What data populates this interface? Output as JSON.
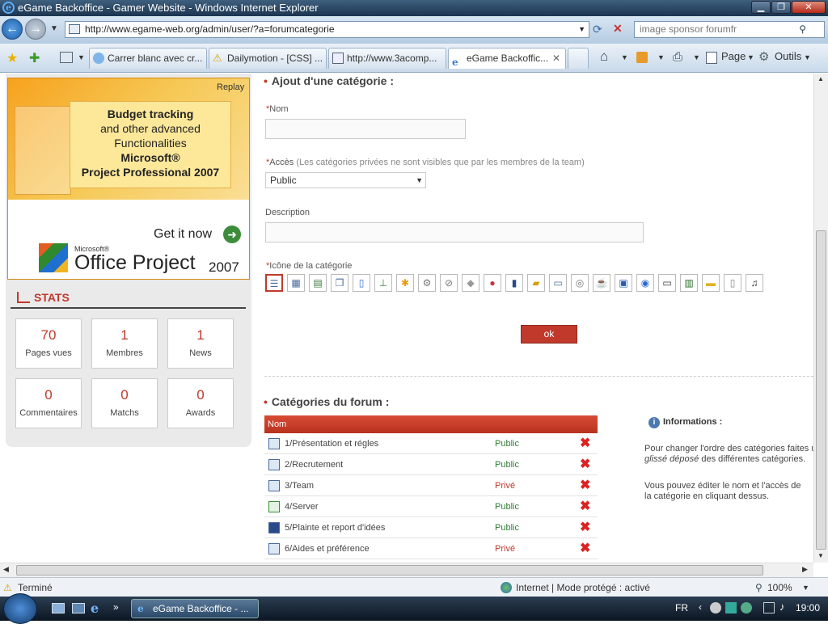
{
  "window": {
    "title": "eGame Backoffice - Gamer Website - Windows Internet Explorer"
  },
  "address": {
    "url": "http://www.egame-web.org/admin/user/?a=forumcategorie",
    "search_placeholder": "image sponsor forumfr"
  },
  "tabs": [
    {
      "label": "Carrer blanc avec cr..."
    },
    {
      "label": "Dailymotion - [CSS] ..."
    },
    {
      "label": "http://www.3acomp..."
    },
    {
      "label": "eGame Backoffic..."
    }
  ],
  "toolbar": {
    "page_label": "Page",
    "tools_label": "Outils"
  },
  "ad": {
    "replay": "Replay",
    "line1": "Budget tracking",
    "line2": "and other advanced",
    "line3": "Functionalities",
    "line4": "Microsoft®",
    "line5": "Project Professional 2007",
    "cta": "Get it now",
    "brand_small": "Microsoft®",
    "brand": "Office Project",
    "brand_year": "2007"
  },
  "stats": {
    "title": "STATS",
    "items": [
      {
        "value": "70",
        "label": "Pages vues"
      },
      {
        "value": "1",
        "label": "Membres"
      },
      {
        "value": "1",
        "label": "News"
      },
      {
        "value": "0",
        "label": "Commentaires"
      },
      {
        "value": "0",
        "label": "Matchs"
      },
      {
        "value": "0",
        "label": "Awards"
      }
    ]
  },
  "form": {
    "title": "Ajout d'une catégorie :",
    "name_label": "Nom",
    "access_label": "Accès",
    "access_hint": "(Les catégories privées ne sont visibles que par les membres de la team)",
    "access_value": "Public",
    "description_label": "Description",
    "icon_label": "Icône de la catégorie",
    "ok_label": "ok"
  },
  "categories": {
    "title": "Catégories du forum :",
    "column_name": "Nom",
    "rows": [
      {
        "name": "1/Présentation et régles",
        "access": "Public"
      },
      {
        "name": "2/Recrutement",
        "access": "Public"
      },
      {
        "name": "3/Team",
        "access": "Privé"
      },
      {
        "name": "4/Server",
        "access": "Public"
      },
      {
        "name": "5/Plainte et report d'idées",
        "access": "Public"
      },
      {
        "name": "6/Aides et préférence",
        "access": "Privé"
      }
    ]
  },
  "info": {
    "title": "Informations :",
    "p1a": "Pour changer l'ordre des catégories faites u",
    "p1b": "glissé déposé",
    "p1c": " des différentes catégories.",
    "p2": "Vous pouvez éditer le nom et l'accès de la catégorie en cliquant dessus."
  },
  "status": {
    "text": "Terminé",
    "zone": "Internet | Mode protégé : activé",
    "zoom": "100%"
  },
  "taskbar": {
    "task_label": "eGame Backoffice - ...",
    "lang": "FR",
    "clock": "19:00"
  },
  "colors": {
    "accent": "#c0392b",
    "public": "#2e7d32",
    "private": "#c0392b"
  }
}
